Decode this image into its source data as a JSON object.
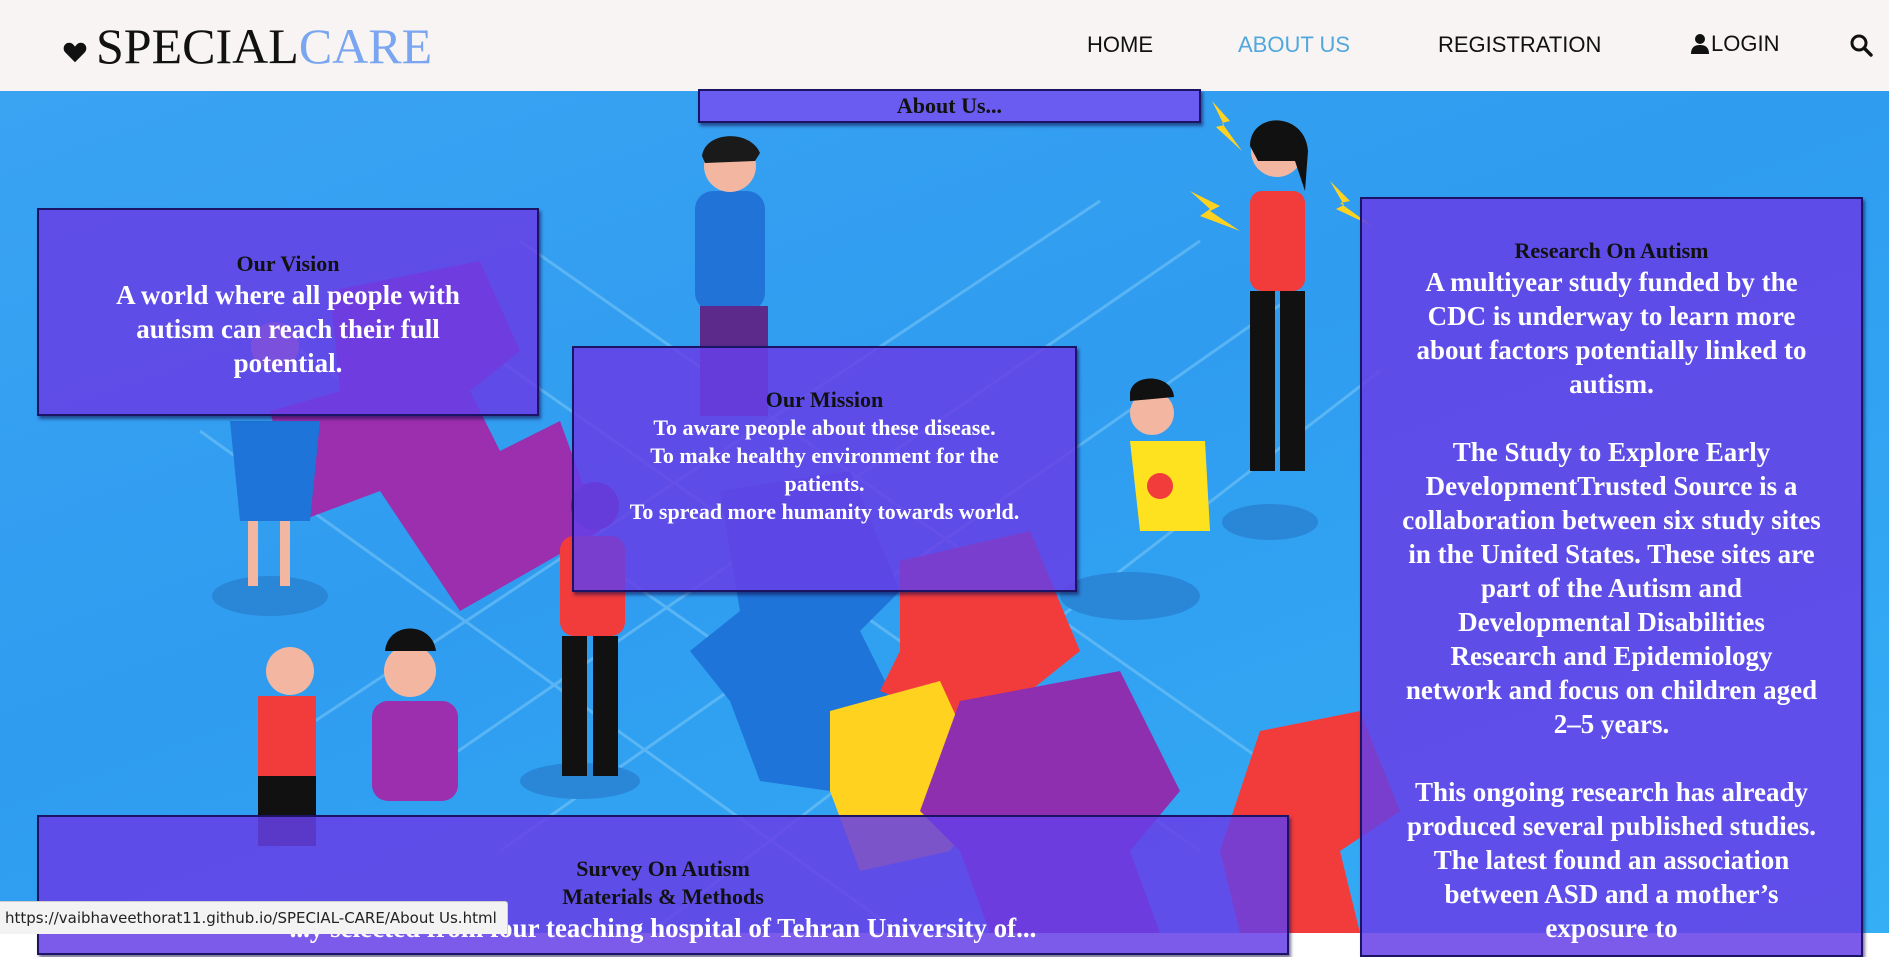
{
  "brand": {
    "icon": "heart-icon",
    "name_part1": "SPECIAL",
    "name_part2": "CARE",
    "accent_color": "#7aa5f0"
  },
  "nav": {
    "home": "HOME",
    "about": "ABOUT US",
    "registration": "REGISTRATION",
    "login": "LOGIN",
    "login_icon": "user-icon",
    "search_icon": "search-icon",
    "active_color": "#52a7dd"
  },
  "about_title": "About Us...",
  "vision": {
    "title": "Our Vision",
    "text": "A world where all people with autism can reach their full potential."
  },
  "mission": {
    "title": "Our Mission",
    "lines": [
      "To aware people about these disease.",
      "To make healthy environment for the patients.",
      "To spread more humanity towards world."
    ]
  },
  "research": {
    "title": "Research On Autism",
    "paragraphs": [
      "A multiyear study funded by the CDC is underway to learn more about factors potentially linked to autism.",
      "The Study to Explore Early DevelopmentTrusted Source is a collaboration between six study sites in the United States. These sites are part of the Autism and Developmental Disabilities Research and Epidemiology network and focus on children aged 2–5 years.",
      "This ongoing research has already produced several published studies. The latest found an association between ASD and a mother’s exposure to"
    ]
  },
  "survey": {
    "title": "Survey On Autism",
    "subtitle": "Materials & Methods",
    "text": "...y selected from four teaching hospital of Tehran University of..."
  },
  "status_bar": {
    "url": "https://vaibhaveethorat11.github.io/SPECIAL-CARE/About Us.html"
  },
  "colors": {
    "panel_fill": "#673fe6",
    "panel_border": "#1b1464",
    "hero_blue": "#2f9cf0"
  }
}
